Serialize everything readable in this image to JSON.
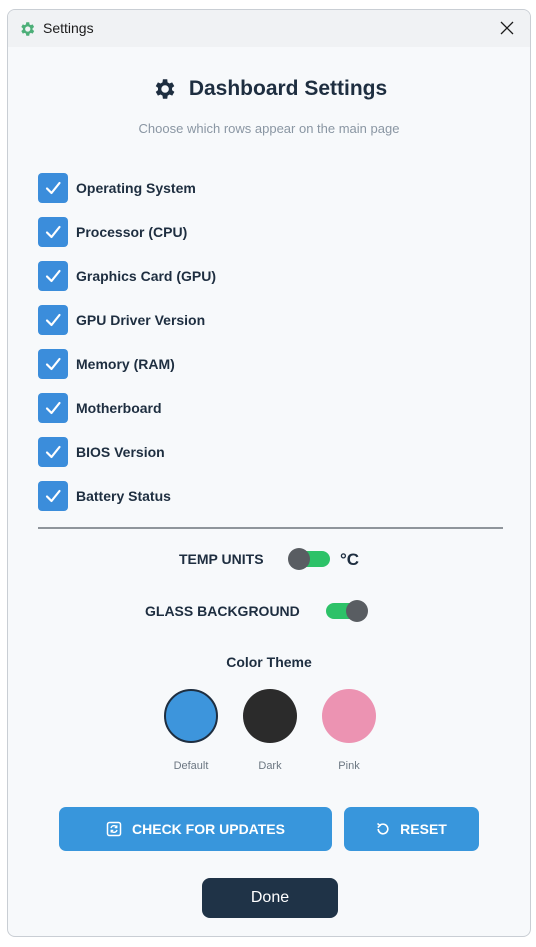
{
  "window": {
    "title": "Settings"
  },
  "header": {
    "title": "Dashboard Settings",
    "subtitle": "Choose which rows appear on the main page"
  },
  "rows": [
    {
      "label": "Operating System",
      "checked": true
    },
    {
      "label": "Processor (CPU)",
      "checked": true
    },
    {
      "label": "Graphics Card (GPU)",
      "checked": true
    },
    {
      "label": "GPU Driver Version",
      "checked": true
    },
    {
      "label": "Memory (RAM)",
      "checked": true
    },
    {
      "label": "Motherboard",
      "checked": true
    },
    {
      "label": "BIOS Version",
      "checked": true
    },
    {
      "label": "Battery Status",
      "checked": true
    }
  ],
  "temp_units": {
    "label": "TEMP UNITS",
    "unit": "°C"
  },
  "glass_background": {
    "label": "GLASS BACKGROUND",
    "on": true
  },
  "color_theme": {
    "title": "Color Theme",
    "selected": "Default",
    "options": [
      {
        "label": "Default",
        "color": "#3d95dc"
      },
      {
        "label": "Dark",
        "color": "#2b2b2b"
      },
      {
        "label": "Pink",
        "color": "#ec93b2"
      }
    ]
  },
  "buttons": {
    "check_updates": "CHECK FOR UPDATES",
    "reset": "RESET",
    "done": "Done"
  },
  "colors": {
    "accent": "#3896dc",
    "toggle_on": "#2dc268",
    "done_bg": "#1f3347",
    "text_dark": "#1e2e40"
  },
  "icons": {
    "title": "gear-icon",
    "close": "close-icon",
    "header": "gear-icon",
    "checkbox": "checkmark-icon",
    "updates": "update-icon",
    "reset": "reset-icon"
  }
}
